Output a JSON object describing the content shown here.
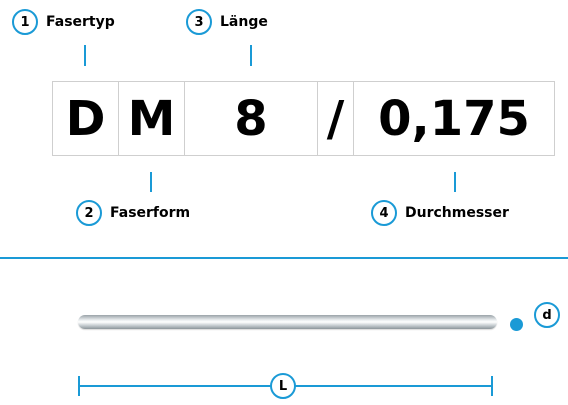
{
  "labels": {
    "fasertyp": {
      "num": "1",
      "text": "Fasertyp"
    },
    "laenge": {
      "num": "3",
      "text": "Länge"
    },
    "faserform": {
      "num": "2",
      "text": "Faserform"
    },
    "durchmesser": {
      "num": "4",
      "text": "Durchmesser"
    }
  },
  "code": {
    "typ": "D",
    "form": "M",
    "laenge": "8",
    "sep": "/",
    "durchmesser": "0,175"
  },
  "dims": {
    "diameter_label": "d",
    "length_label": "L"
  },
  "colors": {
    "accent": "#1a9ad6",
    "border": "#cfcfcf"
  }
}
